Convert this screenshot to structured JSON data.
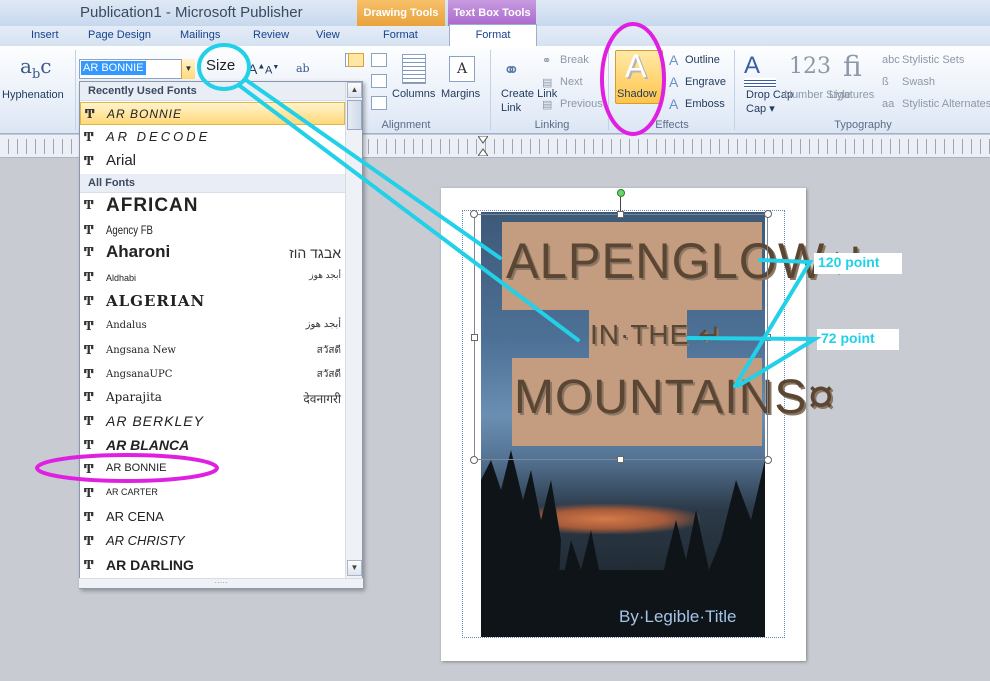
{
  "window": {
    "title": "Publication1  -  Microsoft Publisher",
    "context_tabs": {
      "drawing_tools": "Drawing Tools",
      "text_box_tools": "Text Box Tools"
    }
  },
  "tabs": [
    "Insert",
    "Page Design",
    "Mailings",
    "Review",
    "View",
    "Format",
    "Format"
  ],
  "ribbon": {
    "hyphenation": "Hyphenation",
    "font_value": "AR BONNIE",
    "size_label": "Size",
    "alignment_label": "Alignment",
    "columns": "Columns",
    "margins": "Margins",
    "create_link": "Create Link",
    "break": "Break",
    "next": "Next",
    "previous": "Previous",
    "linking_label": "Linking",
    "shadow": "Shadow",
    "outline": "Outline",
    "engrave": "Engrave",
    "emboss": "Emboss",
    "effects_label": "Effects",
    "drop_cap": "Drop Cap",
    "number_style": "Number Style",
    "ligatures": "Ligatures",
    "stylistic_sets": "Stylistic Sets",
    "swash": "Swash",
    "stylistic_alternates": "Stylistic Alternates",
    "typography_label": "Typography"
  },
  "font_list": {
    "recent_header": "Recently Used Fonts",
    "all_header": "All Fonts",
    "recent": [
      {
        "name": "AR BONNIE",
        "highlighted": true
      },
      {
        "name": "AR DECODE"
      },
      {
        "name": "Arial"
      }
    ],
    "all": [
      {
        "name": "AFRICAN",
        "sample": ""
      },
      {
        "name": "Agency FB",
        "sample": ""
      },
      {
        "name": "Aharoni",
        "sample": "אבגד הוז"
      },
      {
        "name": "Aldhabi",
        "sample": "أبجد هوز"
      },
      {
        "name": "ALGERIAN",
        "sample": ""
      },
      {
        "name": "Andalus",
        "sample": "أبجد هوز"
      },
      {
        "name": "Angsana New",
        "sample": "สวัสดี"
      },
      {
        "name": "AngsanaUPC",
        "sample": "สวัสดี"
      },
      {
        "name": "Aparajita",
        "sample": "देवनागरी"
      },
      {
        "name": "AR BERKLEY",
        "sample": ""
      },
      {
        "name": "AR BLANCA",
        "sample": ""
      },
      {
        "name": "AR BONNIE",
        "sample": ""
      },
      {
        "name": "AR CARTER",
        "sample": ""
      },
      {
        "name": "AR CENA",
        "sample": ""
      },
      {
        "name": "AR CHRISTY",
        "sample": ""
      },
      {
        "name": "AR DARLING",
        "sample": ""
      }
    ]
  },
  "publication": {
    "line1": "ALPENGLOW↵",
    "line2": "IN·THE ↵",
    "line3": "MOUNTAINS¤",
    "byline": "By·Legible·Title"
  },
  "annotations": {
    "size_120": "120 point",
    "size_72": "72 point"
  },
  "colors": {
    "cyan": "#22d0e8",
    "magenta": "#e020e0",
    "banner": "#c49c80"
  }
}
